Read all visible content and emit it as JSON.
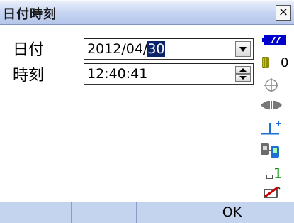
{
  "window": {
    "title": "日付時刻",
    "close_glyph": "×"
  },
  "form": {
    "date_label": "日付",
    "date_value_prefix": "2012/04/",
    "date_value_selected": "30",
    "time_label": "時刻",
    "time_value": "12:40:41"
  },
  "status": {
    "battery_icon": "battery-icon",
    "battery_color": "#0000cc",
    "prism_constant": "0",
    "prism_color": "#c8c800",
    "tilt_icon": "tilt-crosshair-icon",
    "laser_icon": "laser-icon",
    "ppm_icon": "atmospheric-correction-icon",
    "comm_icon": "communication-icon",
    "input_mode": "1",
    "input_mode_color": "#008800",
    "memory_icon": "memory-card-icon"
  },
  "softkeys": [
    "",
    "",
    "",
    "OK",
    ""
  ]
}
